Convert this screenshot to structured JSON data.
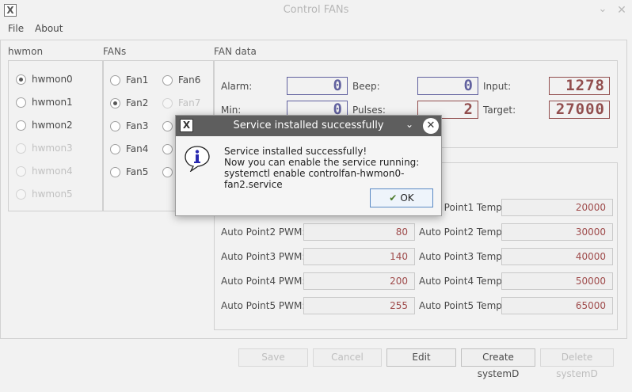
{
  "window": {
    "title": "Control FANs"
  },
  "menu": {
    "file": "File",
    "about": "About"
  },
  "hwmon": {
    "title": "hwmon",
    "items": [
      {
        "label": "hwmon0",
        "checked": true,
        "disabled": false
      },
      {
        "label": "hwmon1",
        "checked": false,
        "disabled": false
      },
      {
        "label": "hwmon2",
        "checked": false,
        "disabled": false
      },
      {
        "label": "hwmon3",
        "checked": false,
        "disabled": true
      },
      {
        "label": "hwmon4",
        "checked": false,
        "disabled": true
      },
      {
        "label": "hwmon5",
        "checked": false,
        "disabled": true
      }
    ]
  },
  "fans": {
    "title": "FANs",
    "col1": [
      "Fan1",
      "Fan2",
      "Fan3",
      "Fan4",
      "Fan5"
    ],
    "col2": [
      "Fan6",
      "Fan7"
    ]
  },
  "fan_data": {
    "title": "FAN data",
    "alarm_label": "Alarm:",
    "alarm": "0",
    "beep_label": "Beep:",
    "beep": "0",
    "input_label": "Input:",
    "input": "1278",
    "min_label": "Min:",
    "min": "0",
    "pulses_label": "Pulses:",
    "pulses": "2",
    "target_label": "Target:",
    "target": "27000"
  },
  "auto_points": {
    "p1_temp_label": "Auto Point1 Temp:",
    "p1_temp": "20000",
    "p2_pwm_label": "Auto Point2 PWM:",
    "p2_pwm": "80",
    "p2_temp_label": "Auto Point2 Temp:",
    "p2_temp": "30000",
    "p3_pwm_label": "Auto Point3 PWM:",
    "p3_pwm": "140",
    "p3_temp_label": "Auto Point3 Temp:",
    "p3_temp": "40000",
    "p4_pwm_label": "Auto Point4 PWM:",
    "p4_pwm": "200",
    "p4_temp_label": "Auto Point4 Temp:",
    "p4_temp": "50000",
    "p5_pwm_label": "Auto Point5 PWM:",
    "p5_pwm": "255",
    "p5_temp_label": "Auto Point5 Temp:",
    "p5_temp": "65000"
  },
  "buttons": {
    "save": "Save",
    "cancel": "Cancel",
    "edit": "Edit",
    "create": "Create systemD",
    "delete": "Delete systemD"
  },
  "dialog": {
    "title": "Service installed successfully",
    "line1": "Service installed successfully!",
    "line2": "Now you can enable the service running:",
    "line3": "systemctl enable controlfan-hwmon0-fan2.service",
    "ok": "OK"
  },
  "colors": {
    "lcd_blue": "#3f3f8a",
    "lcd_red": "#7a2828",
    "dialog_title_bg": "#5e5e5e"
  }
}
